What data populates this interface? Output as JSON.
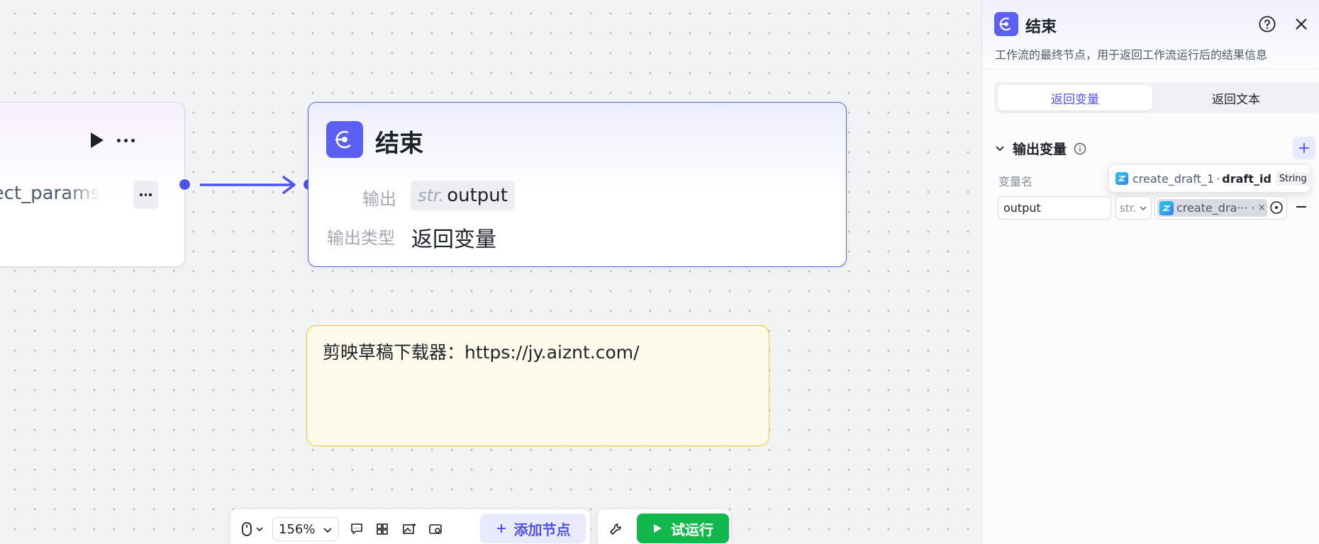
{
  "canvas": {
    "prev_node": {
      "param_text": "effect_params"
    },
    "end_node": {
      "title": "结束",
      "output_label": "输出",
      "output_type_prefix": "str.",
      "output_value": "output",
      "output_type_label": "输出类型",
      "output_type_value": "返回变量"
    },
    "note": {
      "text": "剪映草稿下载器：https://jy.aiznt.com/"
    }
  },
  "toolbar": {
    "zoom": "156%",
    "add_node_label": "添加节点",
    "run_label": "试运行"
  },
  "panel": {
    "title": "结束",
    "description": "工作流的最终节点，用于返回工作流运行后的结果信息",
    "tabs": [
      "返回变量",
      "返回文本"
    ],
    "section_title": "输出变量",
    "add_label": "+",
    "column_var_name": "变量名",
    "tooltip": {
      "node": "create_draft_1",
      "sep": "·",
      "field": "draft_id",
      "type": "String"
    },
    "row": {
      "name": "output",
      "type": "str.",
      "ref_text": "create_dra··· ·",
      "ref_remove": "×"
    }
  },
  "colors": {
    "accent": "#4d53e8",
    "run": "#12b84b",
    "note_border": "#f0c331",
    "note_bg": "#fffbeb"
  }
}
